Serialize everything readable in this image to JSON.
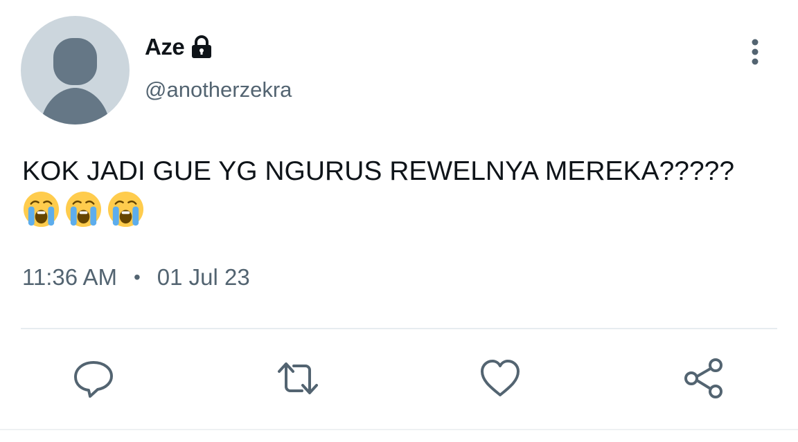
{
  "tweet": {
    "display_name": "Aze",
    "protected_icon": "lock-icon",
    "handle": "@anotherzekra",
    "text": "KOK JADI GUE YG NGURUS REWELNYA MEREKA?????",
    "emojis": [
      "😭",
      "😭",
      "😭"
    ],
    "time": "11:36 AM",
    "separator": "•",
    "date": "01 Jul 23"
  },
  "actions": [
    {
      "icon": "reply-icon"
    },
    {
      "icon": "retweet-icon"
    },
    {
      "icon": "like-icon"
    },
    {
      "icon": "share-icon"
    }
  ],
  "colors": {
    "text": "#0f1419",
    "secondary": "#536471",
    "avatar_bg": "#ccd6dd",
    "avatar_fg": "#657786",
    "divider": "#e6ecf0"
  }
}
